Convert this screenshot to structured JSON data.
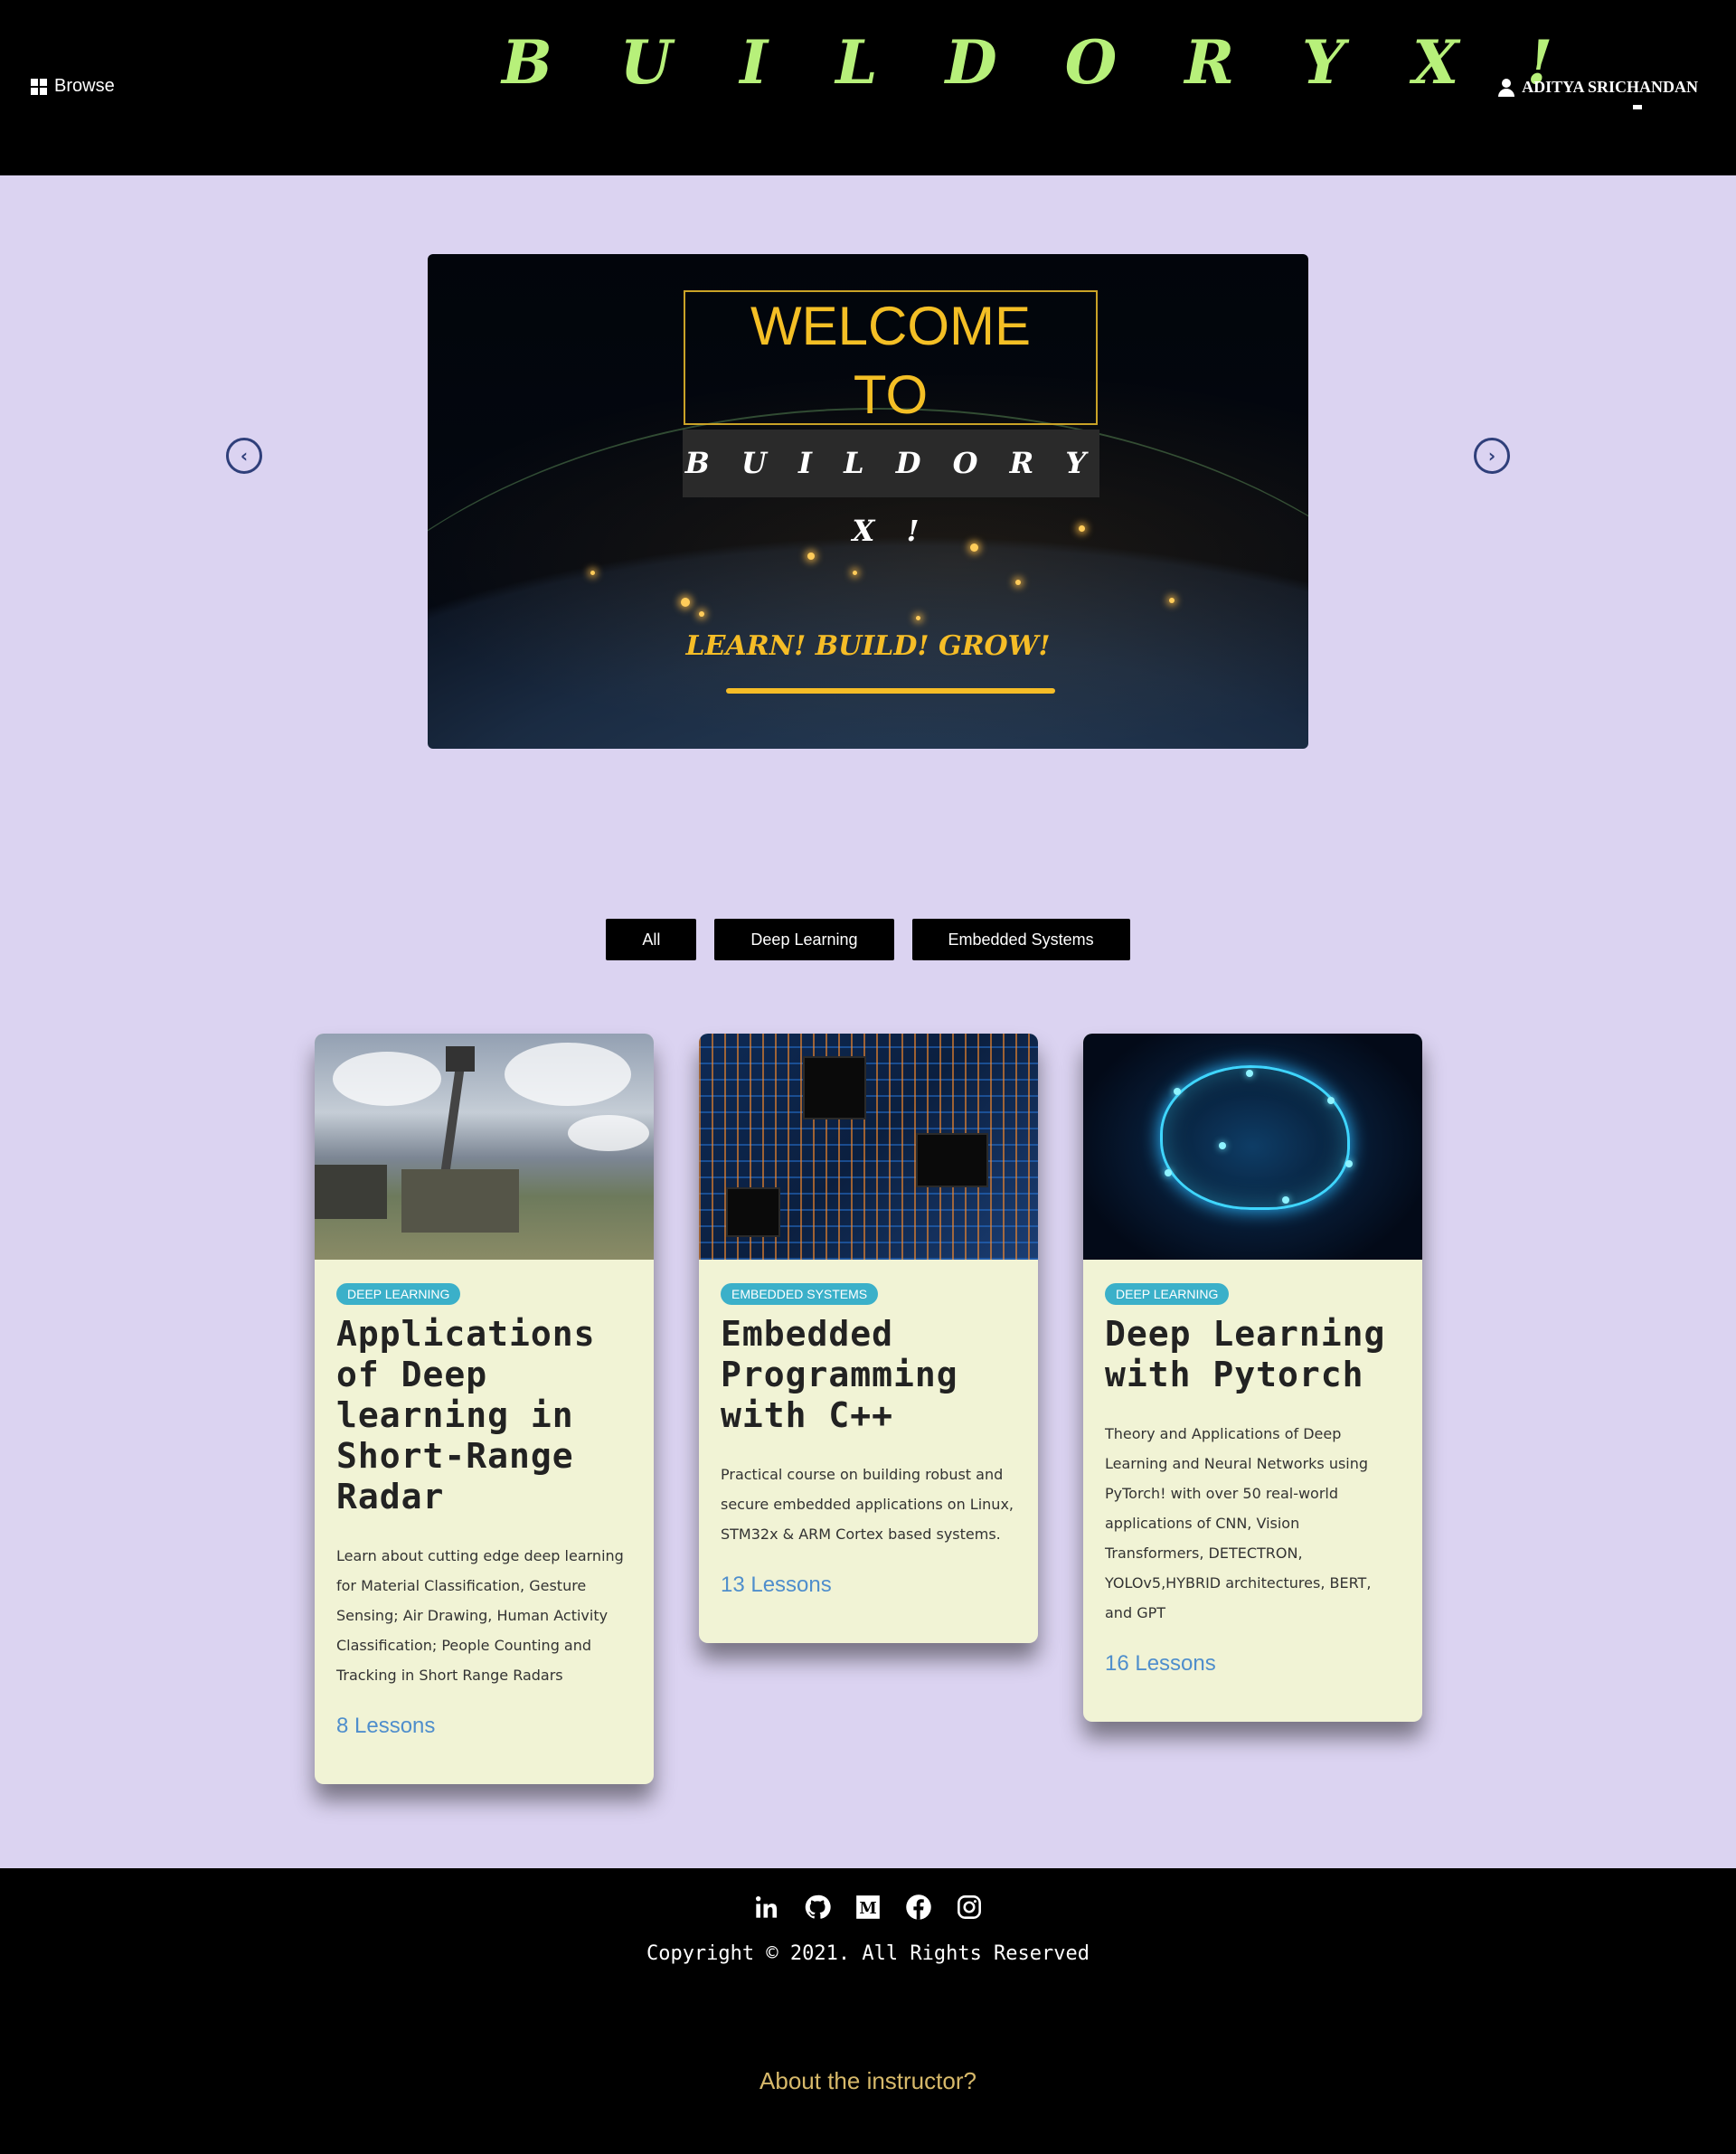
{
  "header": {
    "browse_label": "Browse",
    "brand": "B U I L D O R Y X !",
    "user_name": "ADITYA SRICHANDAN"
  },
  "carousel": {
    "welcome_line1": "WELCOME",
    "welcome_line2": "TO",
    "brand": "B U I L D O R Y X !",
    "tagline": "LEARN! BUILD! GROW!"
  },
  "filters": [
    "All",
    "Deep Learning",
    "Embedded Systems"
  ],
  "courses": [
    {
      "category": "DEEP LEARNING",
      "title": "Applications of Deep learning in Short-Range Radar",
      "description": "Learn about cutting edge deep learning for Material Classification, Gesture Sensing; Air Drawing, Human Activity Classification; People Counting and Tracking in Short Range Radars",
      "lessons": "8 Lessons"
    },
    {
      "category": "EMBEDDED SYSTEMS",
      "title": "Embedded Programming with C++",
      "description": "Practical course on building robust and secure embedded applications on Linux, STM32x & ARM Cortex based systems.",
      "lessons": "13 Lessons"
    },
    {
      "category": "DEEP LEARNING",
      "title": "Deep Learning with Pytorch",
      "description": "Theory and Applications of Deep Learning and Neural Networks using PyTorch! with over 50 real-world applications of CNN, Vision Transformers, DETECTRON, YOLOv5,HYBRID architectures, BERT, and GPT",
      "lessons": "16 Lessons"
    }
  ],
  "footer": {
    "social_icons": [
      "linkedin-icon",
      "github-icon",
      "medium-icon",
      "facebook-icon",
      "instagram-icon"
    ],
    "copyright": "Copyright © 2021. All Rights Reserved",
    "about": "About the instructor?"
  },
  "colors": {
    "header_bg": "#000000",
    "page_bg": "#dbd3f1",
    "brand": "#b7f07a",
    "accent_gold": "#f6bd27",
    "badge": "#3bb0c9",
    "lessons_link": "#4f8ecc",
    "card_bg": "#f1f3d5"
  }
}
